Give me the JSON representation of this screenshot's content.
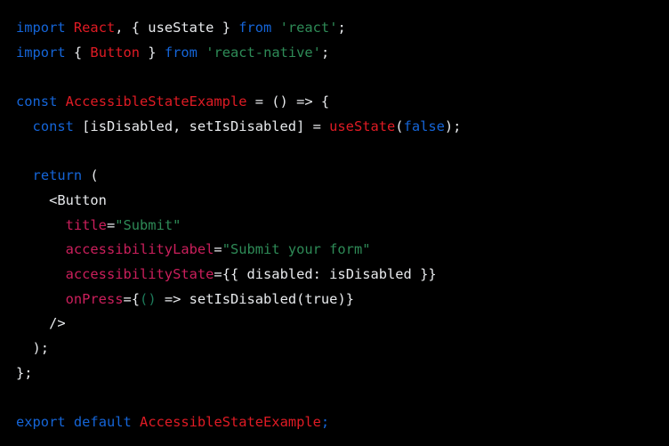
{
  "editor": {
    "language": "jsx",
    "background_color": "#000000",
    "font_size_px": 15.4,
    "line_height_px": 27.7
  },
  "theme": {
    "keyword_color": "#1565d8",
    "identifier_color": "#e8eaed",
    "component_color": "#e01b24",
    "string_color": "#2e8b57",
    "attribute_color": "#cc1f5c",
    "boolean_color": "#1565d8",
    "punctuation_color": "#e8eaed",
    "arrow_paren_color": "#1d7a5a"
  },
  "code": {
    "full_text": "import React, { useState } from 'react';\nimport { Button } from 'react-native';\n\nconst AccessibleStateExample = () => {\n  const [isDisabled, setIsDisabled] = useState(false);\n\n  return (\n    <Button\n      title=\"Submit\"\n      accessibilityLabel=\"Submit your form\"\n      accessibilityState={{ disabled: isDisabled }}\n      onPress={() => setIsDisabled(true)}\n    />\n  );\n};\n\nexport default AccessibleStateExample;",
    "lines": [
      {
        "number": 1,
        "tokens": [
          {
            "text": "import",
            "kind": "keyword"
          },
          {
            "text": " ",
            "kind": "plain"
          },
          {
            "text": "React",
            "kind": "component"
          },
          {
            "text": ", { useState } ",
            "kind": "plain"
          },
          {
            "text": "from",
            "kind": "keyword"
          },
          {
            "text": " ",
            "kind": "plain"
          },
          {
            "text": "'react'",
            "kind": "string"
          },
          {
            "text": ";",
            "kind": "plain"
          }
        ]
      },
      {
        "number": 2,
        "tokens": [
          {
            "text": "import",
            "kind": "keyword"
          },
          {
            "text": " { ",
            "kind": "plain"
          },
          {
            "text": "Button",
            "kind": "component"
          },
          {
            "text": " } ",
            "kind": "plain"
          },
          {
            "text": "from",
            "kind": "keyword"
          },
          {
            "text": " ",
            "kind": "plain"
          },
          {
            "text": "'react-native'",
            "kind": "string"
          },
          {
            "text": ";",
            "kind": "plain"
          }
        ]
      },
      {
        "number": 3,
        "tokens": []
      },
      {
        "number": 4,
        "tokens": [
          {
            "text": "const",
            "kind": "keyword"
          },
          {
            "text": " ",
            "kind": "plain"
          },
          {
            "text": "AccessibleStateExample",
            "kind": "component"
          },
          {
            "text": " = () => {",
            "kind": "plain"
          }
        ]
      },
      {
        "number": 5,
        "tokens": [
          {
            "text": "  ",
            "kind": "plain"
          },
          {
            "text": "const",
            "kind": "keyword"
          },
          {
            "text": " [isDisabled, setIsDisabled] = ",
            "kind": "plain"
          },
          {
            "text": "useState",
            "kind": "component"
          },
          {
            "text": "(",
            "kind": "plain"
          },
          {
            "text": "false",
            "kind": "boolean"
          },
          {
            "text": ");",
            "kind": "plain"
          }
        ]
      },
      {
        "number": 6,
        "tokens": []
      },
      {
        "number": 7,
        "tokens": [
          {
            "text": "  ",
            "kind": "plain"
          },
          {
            "text": "return",
            "kind": "keyword"
          },
          {
            "text": " (",
            "kind": "plain"
          }
        ]
      },
      {
        "number": 8,
        "tokens": [
          {
            "text": "    <Button",
            "kind": "plain"
          }
        ]
      },
      {
        "number": 9,
        "tokens": [
          {
            "text": "      ",
            "kind": "plain"
          },
          {
            "text": "title",
            "kind": "attribute"
          },
          {
            "text": "=",
            "kind": "plain"
          },
          {
            "text": "\"Submit\"",
            "kind": "string"
          }
        ]
      },
      {
        "number": 10,
        "tokens": [
          {
            "text": "      ",
            "kind": "plain"
          },
          {
            "text": "accessibilityLabel",
            "kind": "attribute"
          },
          {
            "text": "=",
            "kind": "plain"
          },
          {
            "text": "\"Submit your form\"",
            "kind": "string"
          }
        ]
      },
      {
        "number": 11,
        "tokens": [
          {
            "text": "      ",
            "kind": "plain"
          },
          {
            "text": "accessibilityState",
            "kind": "attribute"
          },
          {
            "text": "=",
            "kind": "plain"
          },
          {
            "text": "{{",
            "kind": "plain"
          },
          {
            "text": " disabled: isDisabled ",
            "kind": "plain"
          },
          {
            "text": "}}",
            "kind": "plain"
          }
        ]
      },
      {
        "number": 12,
        "tokens": [
          {
            "text": "      ",
            "kind": "plain"
          },
          {
            "text": "onPress",
            "kind": "attribute"
          },
          {
            "text": "=",
            "kind": "plain"
          },
          {
            "text": "{",
            "kind": "plain"
          },
          {
            "text": "()",
            "kind": "arrow_paren"
          },
          {
            "text": " => setIsDisabled(true)}",
            "kind": "plain"
          }
        ]
      },
      {
        "number": 13,
        "tokens": [
          {
            "text": "    />",
            "kind": "plain"
          }
        ]
      },
      {
        "number": 14,
        "tokens": [
          {
            "text": "  );",
            "kind": "plain"
          }
        ]
      },
      {
        "number": 15,
        "tokens": [
          {
            "text": "};",
            "kind": "plain"
          }
        ]
      },
      {
        "number": 16,
        "tokens": []
      },
      {
        "number": 17,
        "tokens": [
          {
            "text": "export",
            "kind": "keyword"
          },
          {
            "text": " ",
            "kind": "plain"
          },
          {
            "text": "default",
            "kind": "keyword"
          },
          {
            "text": " ",
            "kind": "plain"
          },
          {
            "text": "AccessibleStateExample",
            "kind": "component"
          },
          {
            "text": ";",
            "kind": "keyword"
          }
        ]
      }
    ]
  }
}
